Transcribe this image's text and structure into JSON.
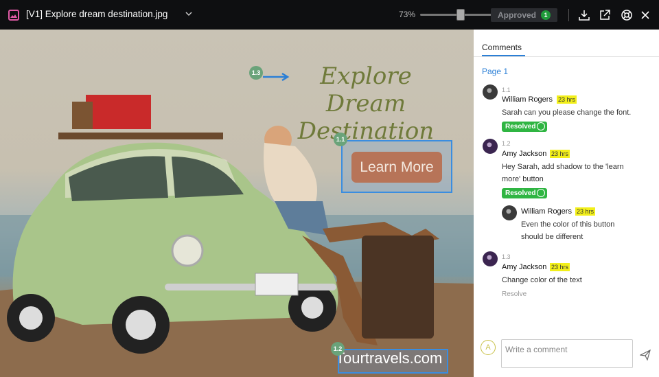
{
  "header": {
    "file_title": "[V1] Explore dream destination.jpg",
    "zoom": "73%",
    "zoom_level": 0.73,
    "status_label": "Approved",
    "status_count": "1",
    "icons": [
      "image-file-icon",
      "chevron-down-icon",
      "download-icon",
      "open-external-icon",
      "help-icon",
      "close-icon"
    ]
  },
  "canvas": {
    "headline": "Explore Dream Destination",
    "button_text": "Learn More",
    "website": "Tourtravels.com",
    "pins": [
      "1.1",
      "1.2",
      "1.3"
    ]
  },
  "sidebar": {
    "tab": "Comments",
    "page_label": "Page 1",
    "comments": [
      {
        "num": "1.1",
        "author": "William Rogers",
        "time": "23 hrs",
        "text": "Sarah can you please change the font.",
        "status": "Resolved"
      },
      {
        "num": "1.2",
        "author": "Amy Jackson",
        "time": "23 hrs",
        "text": "Hey Sarah, add shadow to the 'learn more' button",
        "status": "Resolved",
        "reply": {
          "author": "William Rogers",
          "time": "23 hrs",
          "text": "Even the color of this button should be different"
        }
      },
      {
        "num": "1.3",
        "author": "Amy Jackson",
        "time": "23 hrs",
        "text": "Change color of the text",
        "action": "Resolve"
      }
    ],
    "composer": {
      "avatar_letter": "A",
      "placeholder": "Write a comment"
    }
  },
  "colors": {
    "accent": "#2b7fd6",
    "resolved": "#2fb542",
    "time_highlight": "#f2ef1a",
    "topbar": "#0e0f11"
  }
}
